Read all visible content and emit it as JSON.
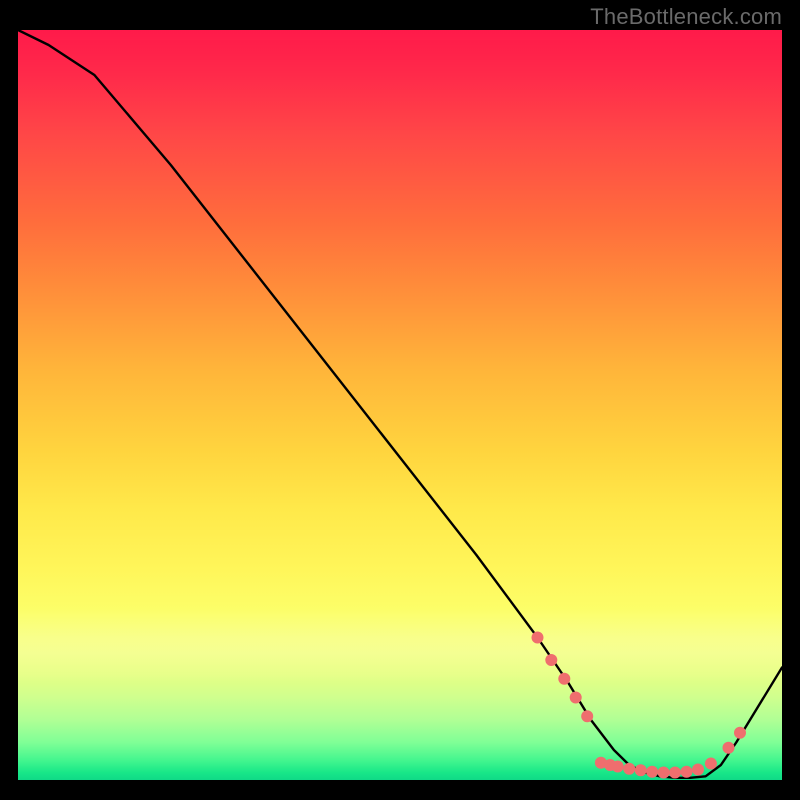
{
  "watermark": "TheBottleneck.com",
  "chart_data": {
    "type": "line",
    "title": "",
    "xlabel": "",
    "ylabel": "",
    "xlim": [
      0,
      100
    ],
    "ylim": [
      0,
      100
    ],
    "grid": false,
    "legend": false,
    "series": [
      {
        "name": "bottleneck-curve",
        "color": "#000000",
        "x": [
          0,
          4,
          10,
          20,
          30,
          40,
          50,
          60,
          68,
          72,
          75,
          78,
          80,
          82,
          84,
          86,
          88,
          90,
          92,
          94,
          100
        ],
        "values": [
          100,
          98,
          94,
          82,
          69,
          56,
          43,
          30,
          19,
          13,
          8,
          4,
          2,
          1,
          0.5,
          0.3,
          0.3,
          0.5,
          2,
          5,
          15
        ]
      }
    ],
    "markers": [
      {
        "name": "highlighted-points",
        "color": "#ef6e6e",
        "radius": 6,
        "points": [
          {
            "x": 68.0,
            "y": 19.0
          },
          {
            "x": 69.8,
            "y": 16.0
          },
          {
            "x": 71.5,
            "y": 13.5
          },
          {
            "x": 73.0,
            "y": 11.0
          },
          {
            "x": 74.5,
            "y": 8.5
          },
          {
            "x": 76.3,
            "y": 2.3
          },
          {
            "x": 77.5,
            "y": 2.0
          },
          {
            "x": 78.5,
            "y": 1.8
          },
          {
            "x": 80.0,
            "y": 1.5
          },
          {
            "x": 81.5,
            "y": 1.3
          },
          {
            "x": 83.0,
            "y": 1.1
          },
          {
            "x": 84.5,
            "y": 1.0
          },
          {
            "x": 86.0,
            "y": 1.0
          },
          {
            "x": 87.5,
            "y": 1.1
          },
          {
            "x": 89.0,
            "y": 1.4
          },
          {
            "x": 90.7,
            "y": 2.2
          },
          {
            "x": 93.0,
            "y": 4.3
          },
          {
            "x": 94.5,
            "y": 6.3
          }
        ]
      }
    ],
    "background_gradient": {
      "top": "#ff1a4a",
      "mid": "#ffe94a",
      "bottom": "#18e788"
    }
  }
}
